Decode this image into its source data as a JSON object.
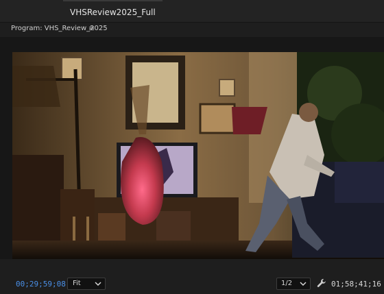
{
  "sequence_tab": {
    "label": "VHSReview2025_Full"
  },
  "program_monitor": {
    "title": "Program: VHS_Review_2025",
    "menu_icon": "hamburger-menu-icon"
  },
  "controls": {
    "playhead_timecode": "00;29;59;08",
    "zoom_value": "Fit",
    "resolution_value": "1/2",
    "settings_icon": "wrench-icon",
    "duration_timecode": "01;58;41;16"
  },
  "colors": {
    "timecode_accent": "#4a8fe7",
    "panel_bg": "#1e1e1e"
  }
}
